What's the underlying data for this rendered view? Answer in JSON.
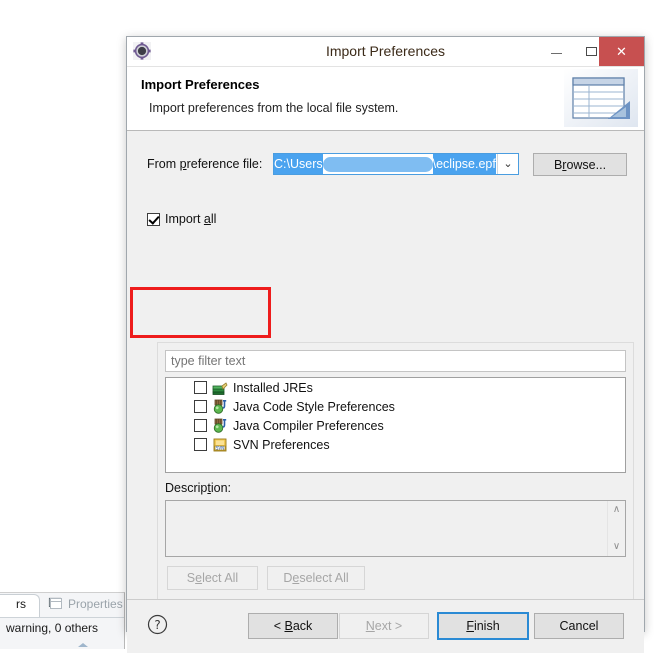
{
  "window": {
    "title": "Import Preferences",
    "icon": "eclipse-gear-icon",
    "minimize_label": "–",
    "maximize_label": "❑",
    "close_label": "✕"
  },
  "banner": {
    "title": "Import Preferences",
    "subtitle": "Import preferences from the local file system.",
    "image": "import-table-banner-icon"
  },
  "file_section": {
    "label_prefix": "From ",
    "label_accel": "p",
    "label_suffix": "reference file:",
    "path_prefix": "C:\\Users",
    "path_redacted": "",
    "path_suffix": "\\eclipse.epf",
    "combo_arrow": "⌄",
    "browse_prefix": "B",
    "browse_accel": "r",
    "browse_suffix": "owse..."
  },
  "import_all": {
    "label_prefix": "Import ",
    "label_accel": "a",
    "label_suffix": "ll",
    "checked": true
  },
  "annotation": {
    "color": "#ee1c1c",
    "target": "import-all-checkbox"
  },
  "tree_section": {
    "filter_placeholder": "type filter text",
    "items": [
      {
        "label": "Installed JREs",
        "icon": "installed-jres-icon",
        "checked": false
      },
      {
        "label": "Java Code Style Preferences",
        "icon": "java-preferences-icon",
        "checked": false
      },
      {
        "label": "Java Compiler Preferences",
        "icon": "java-preferences-icon",
        "checked": false
      },
      {
        "label": "SVN Preferences",
        "icon": "svn-preferences-icon",
        "checked": false
      }
    ],
    "description_prefix": "Descrip",
    "description_accel": "t",
    "description_suffix": "ion:",
    "description_value": "",
    "scroll_up": "∧",
    "scroll_down": "∨",
    "select_all_prefix": "S",
    "select_all_accel": "e",
    "select_all_suffix": "lect All",
    "deselect_all_prefix": "D",
    "deselect_all_accel": "e",
    "deselect_all_suffix": "select All"
  },
  "footer": {
    "help_label": "?",
    "back_prefix": "< ",
    "back_accel": "B",
    "back_suffix": "ack",
    "next_prefix": "",
    "next_accel": "N",
    "next_suffix": "ext >",
    "finish_prefix": "",
    "finish_accel": "F",
    "finish_suffix": "inish",
    "cancel_label": "Cancel"
  },
  "background": {
    "tab_label": "rs",
    "tab_close": "⌧",
    "properties_tab": "Properties",
    "status_text": "warning, 0 others"
  }
}
